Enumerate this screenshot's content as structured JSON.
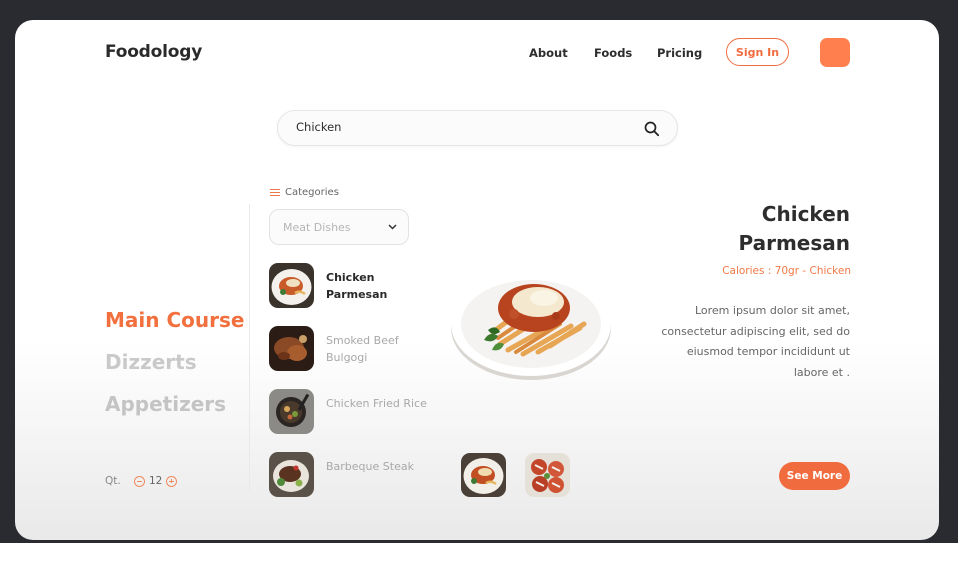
{
  "header": {
    "logo": "Foodology",
    "nav": [
      "About",
      "Foods",
      "Pricing"
    ],
    "signin_label": "Sign In",
    "accent": "#f06c3f"
  },
  "search": {
    "value": "Chicken",
    "icon": "search-icon"
  },
  "categories": {
    "label": "Categories",
    "selected": "Meat Dishes",
    "icon": "menu-icon"
  },
  "courses": [
    "Main Course",
    "Dizzerts",
    "Appetizers"
  ],
  "quantity": {
    "label": "Qt.",
    "value": "12"
  },
  "menu_items": [
    {
      "name": "Chicken Parmesan",
      "active": true
    },
    {
      "name": "Smoked Beef Bulgogi",
      "active": false
    },
    {
      "name": "Chicken Fried Rice",
      "active": false
    },
    {
      "name": "Barbeque Steak",
      "active": false
    }
  ],
  "detail": {
    "title_line1": "Chicken",
    "title_line2": "Parmesan",
    "calories": "Calories : 70gr - Chicken",
    "description": "Lorem ipsum dolor sit amet, consectetur adipiscing elit, sed do eiusmod tempor incididunt ut labore et .",
    "see_more_label": "See More"
  }
}
